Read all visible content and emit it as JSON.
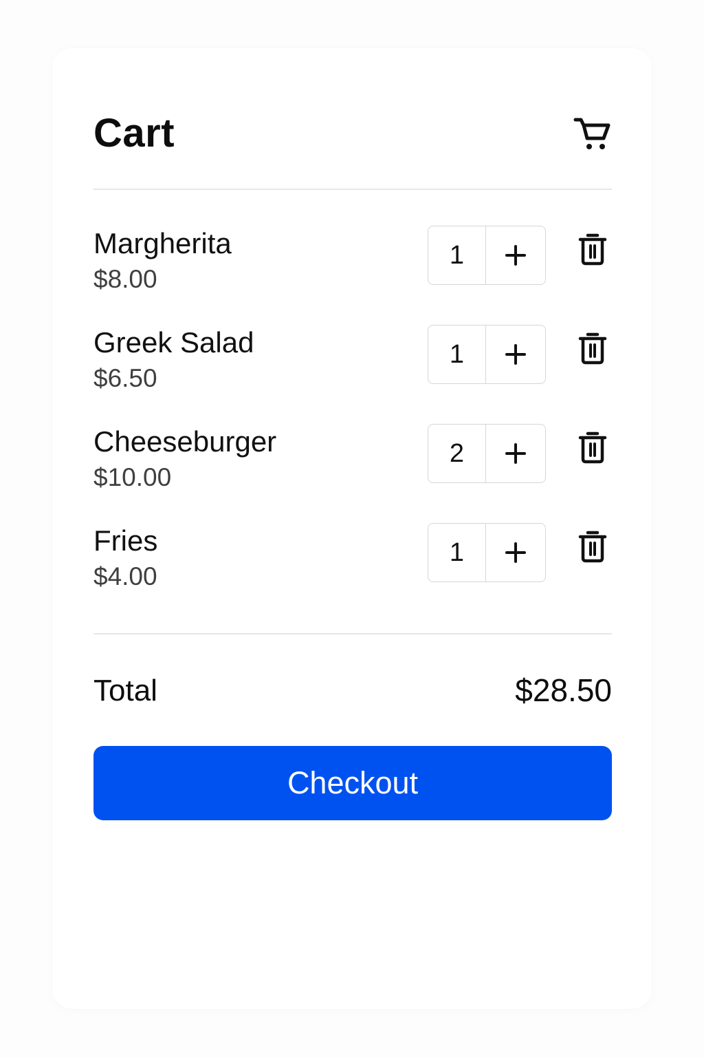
{
  "header": {
    "title": "Cart",
    "icon": "cart-icon"
  },
  "items": [
    {
      "name": "Margherita",
      "price": "$8.00",
      "quantity": "1"
    },
    {
      "name": "Greek Salad",
      "price": "$6.50",
      "quantity": "1"
    },
    {
      "name": "Cheeseburger",
      "price": "$10.00",
      "quantity": "2"
    },
    {
      "name": "Fries",
      "price": "$4.00",
      "quantity": "1"
    }
  ],
  "item_icons": {
    "increase": "plus-icon",
    "remove": "trash-icon"
  },
  "summary": {
    "total_label": "Total",
    "total_value": "$28.50"
  },
  "checkout": {
    "label": "Checkout"
  },
  "colors": {
    "accent": "#0052f0",
    "text": "#111111",
    "muted_text": "#3f3f3f",
    "border": "#d6d6d6"
  }
}
